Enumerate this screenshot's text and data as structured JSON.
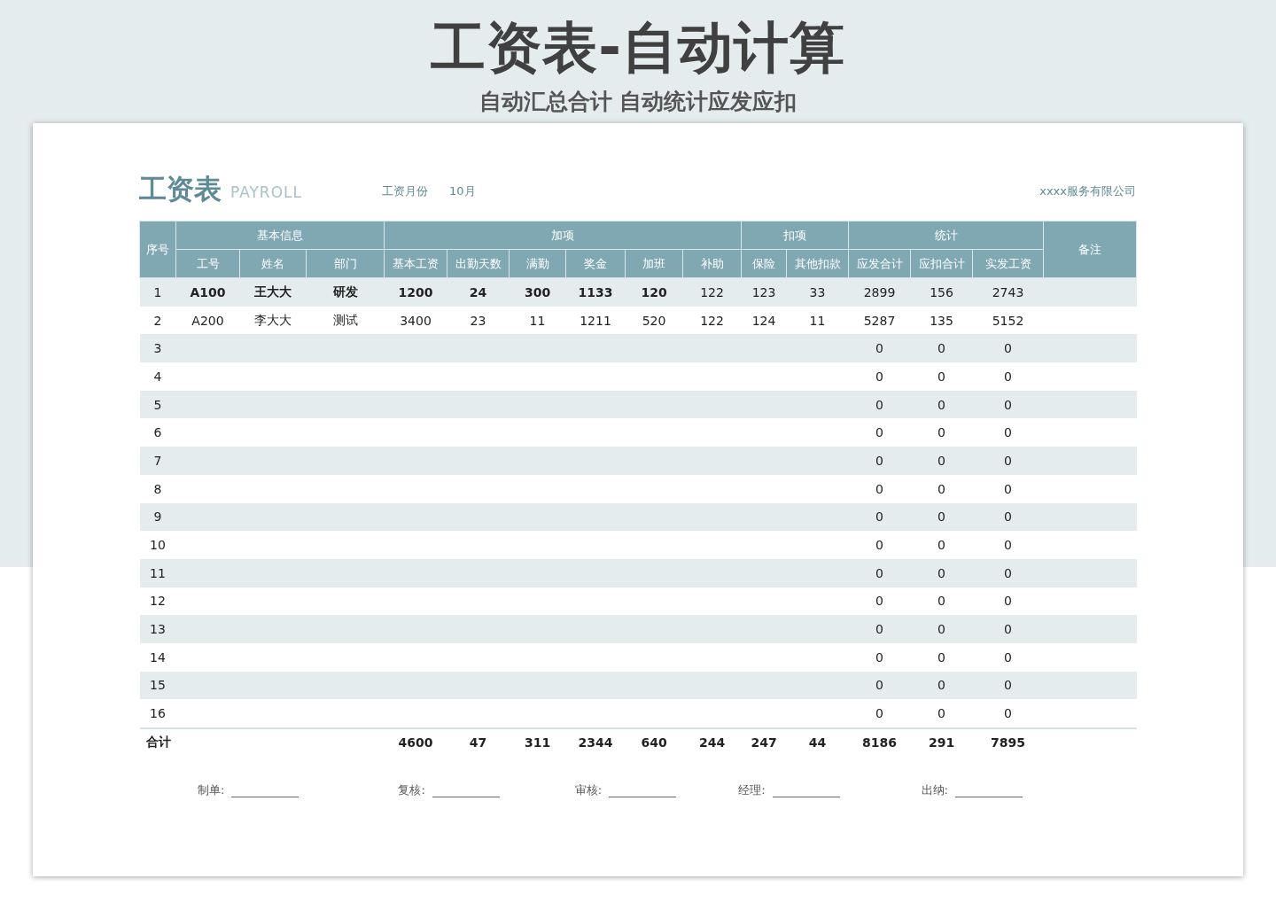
{
  "banner": {
    "title": "工资表-自动计算",
    "subtitle": "自动汇总合计 自动统计应发应扣"
  },
  "sheet": {
    "title": "工资表",
    "title_en": "PAYROLL",
    "month_label": "工资月份",
    "month": "10月",
    "company": "xxxx服务有限公司"
  },
  "table": {
    "groups": [
      "序号",
      "基本信息",
      "加项",
      "扣项",
      "统计",
      "备注"
    ],
    "columns": [
      "工号",
      "姓名",
      "部门",
      "基本工资",
      "出勤天数",
      "满勤",
      "奖金",
      "加班",
      "补助",
      "保险",
      "其他扣款",
      "应发合计",
      "应扣合计",
      "实发工资"
    ],
    "rows": [
      {
        "no": "1",
        "bold": true,
        "id": "A100",
        "name": "王大大",
        "dept": "研发",
        "base": "1200",
        "days": "24",
        "full": "300",
        "bonus": "1133",
        "ot": "120",
        "allow": "122",
        "ins": "123",
        "other": "33",
        "gross": "2899",
        "deduct": "156",
        "net": "2743"
      },
      {
        "no": "2",
        "bold": false,
        "id": "A200",
        "name": "李大大",
        "dept": "测试",
        "base": "3400",
        "days": "23",
        "full": "11",
        "bonus": "1211",
        "ot": "520",
        "allow": "122",
        "ins": "124",
        "other": "11",
        "gross": "5287",
        "deduct": "135",
        "net": "5152"
      },
      {
        "no": "3",
        "gross": "0",
        "deduct": "0",
        "net": "0"
      },
      {
        "no": "4",
        "gross": "0",
        "deduct": "0",
        "net": "0"
      },
      {
        "no": "5",
        "gross": "0",
        "deduct": "0",
        "net": "0"
      },
      {
        "no": "6",
        "gross": "0",
        "deduct": "0",
        "net": "0"
      },
      {
        "no": "7",
        "gross": "0",
        "deduct": "0",
        "net": "0"
      },
      {
        "no": "8",
        "gross": "0",
        "deduct": "0",
        "net": "0"
      },
      {
        "no": "9",
        "gross": "0",
        "deduct": "0",
        "net": "0"
      },
      {
        "no": "10",
        "gross": "0",
        "deduct": "0",
        "net": "0"
      },
      {
        "no": "11",
        "gross": "0",
        "deduct": "0",
        "net": "0"
      },
      {
        "no": "12",
        "gross": "0",
        "deduct": "0",
        "net": "0"
      },
      {
        "no": "13",
        "gross": "0",
        "deduct": "0",
        "net": "0"
      },
      {
        "no": "14",
        "gross": "0",
        "deduct": "0",
        "net": "0"
      },
      {
        "no": "15",
        "gross": "0",
        "deduct": "0",
        "net": "0"
      },
      {
        "no": "16",
        "gross": "0",
        "deduct": "0",
        "net": "0"
      }
    ],
    "total": {
      "no": "合计",
      "base": "4600",
      "days": "47",
      "full": "311",
      "bonus": "2344",
      "ot": "640",
      "allow": "244",
      "ins": "247",
      "other": "44",
      "gross": "8186",
      "deduct": "291",
      "net": "7895"
    }
  },
  "signatures": [
    "制单:",
    "复核:",
    "审核:",
    "经理:",
    "出纳:"
  ]
}
